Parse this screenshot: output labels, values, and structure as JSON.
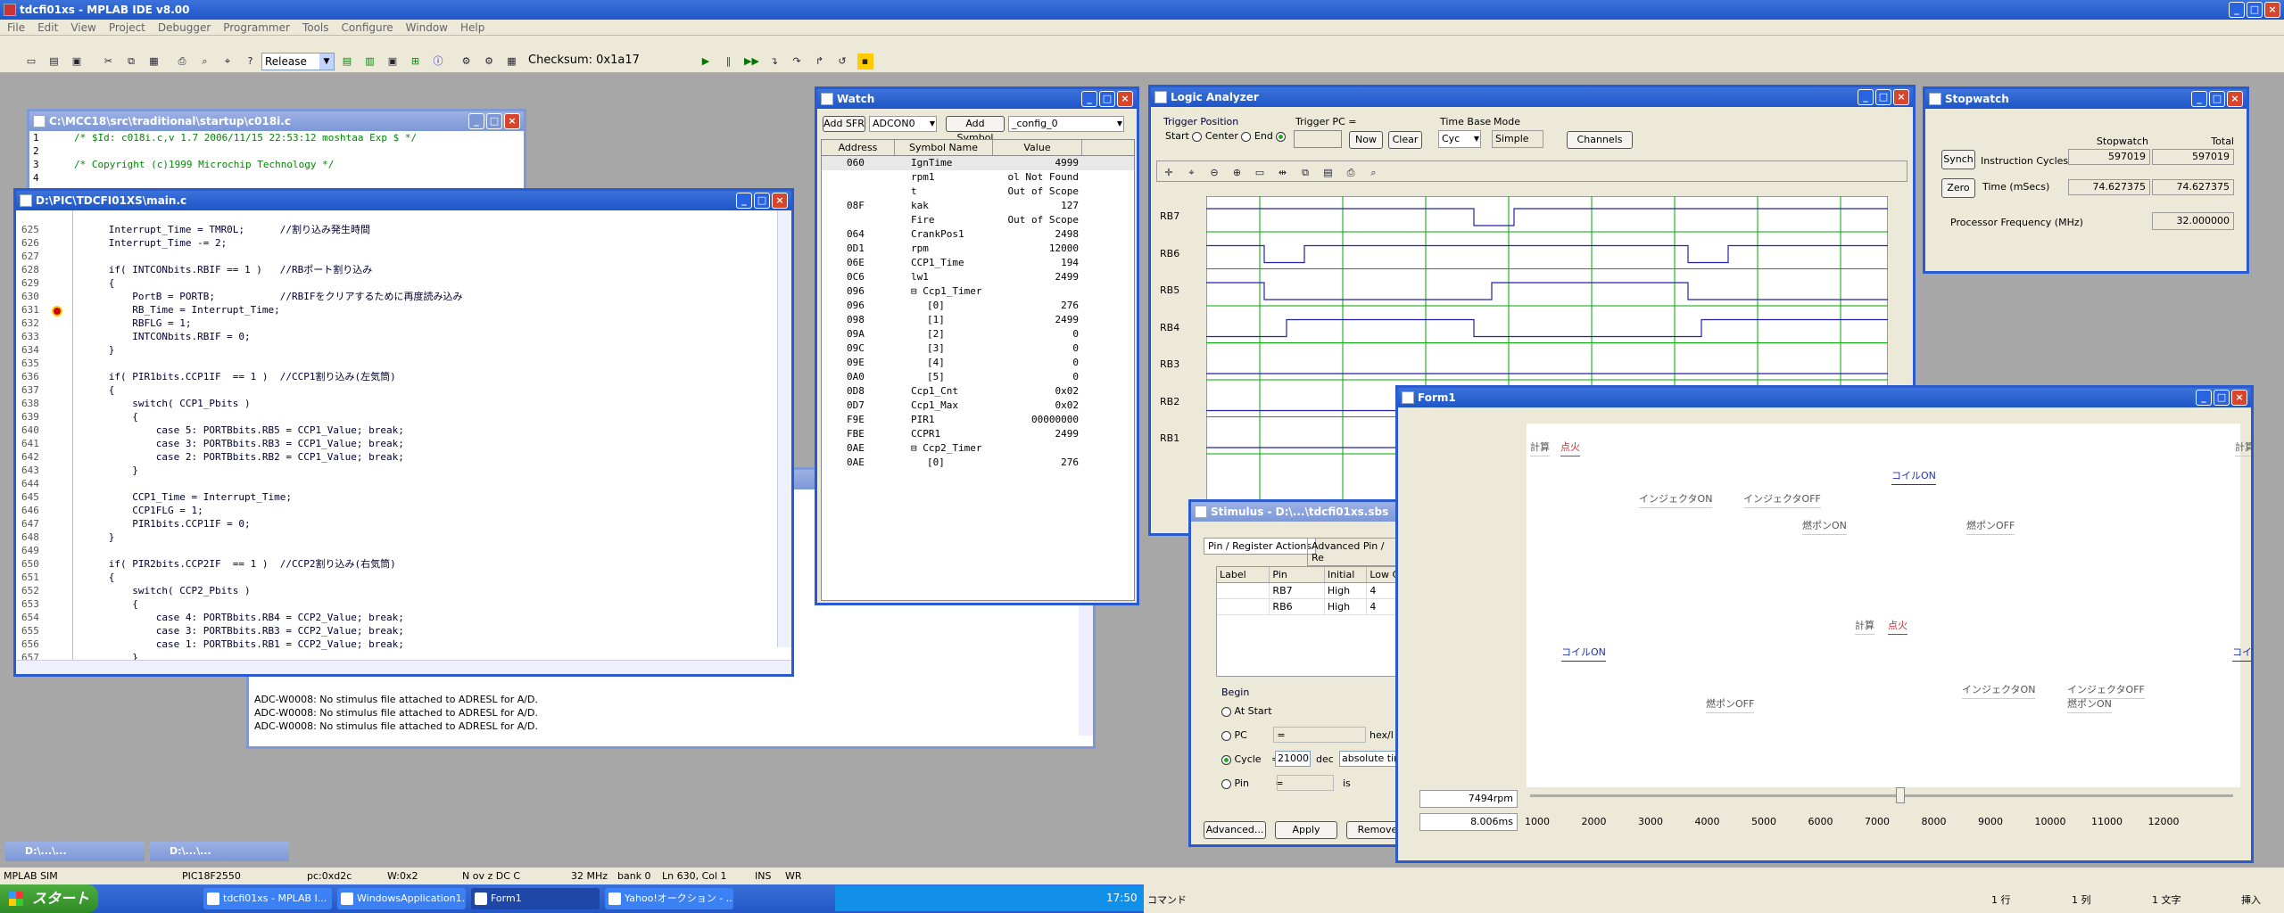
{
  "app": {
    "title": "tdcfi01xs - MPLAB IDE v8.00"
  },
  "menu": [
    "File",
    "Edit",
    "View",
    "Project",
    "Debugger",
    "Programmer",
    "Tools",
    "Configure",
    "Window",
    "Help"
  ],
  "toolbar": {
    "config": "Release",
    "checksum": "Checksum: 0x1a17"
  },
  "c018i": {
    "title": "C:\\MCC18\\src\\traditional\\startup\\c018i.c",
    "lines": [
      {
        "n": "1",
        "t": "/* $Id: c018i.c,v 1.7 2006/11/15 22:53:12 moshtaa Exp $ */"
      },
      {
        "n": "2",
        "t": ""
      },
      {
        "n": "3",
        "t": "/* Copyright (c)1999 Microchip Technology */"
      },
      {
        "n": "4",
        "t": ""
      }
    ]
  },
  "main": {
    "title": "D:\\PIC\\TDCFI01XS\\main.c",
    "lines": [
      {
        "n": "625",
        "t": "      Interrupt_Time = TMR0L;      //割り込み発生時間"
      },
      {
        "n": "626",
        "t": "      Interrupt_Time -= 2;"
      },
      {
        "n": "627",
        "t": ""
      },
      {
        "n": "628",
        "t": "      if( INTCONbits.RBIF == 1 )   //RBポート割り込み"
      },
      {
        "n": "629",
        "t": "      {"
      },
      {
        "n": "630",
        "t": "          PortB = PORTB;           //RBIFをクリアするために再度読み込み"
      },
      {
        "n": "631",
        "t": "          RB_Time = Interrupt_Time;"
      },
      {
        "n": "632",
        "t": "          RBFLG = 1;"
      },
      {
        "n": "633",
        "t": "          INTCONbits.RBIF = 0;"
      },
      {
        "n": "634",
        "t": "      }"
      },
      {
        "n": "635",
        "t": ""
      },
      {
        "n": "636",
        "t": "      if( PIR1bits.CCP1IF  == 1 )  //CCP1割り込み(左気筒)"
      },
      {
        "n": "637",
        "t": "      {"
      },
      {
        "n": "638",
        "t": "          switch( CCP1_Pbits )"
      },
      {
        "n": "639",
        "t": "          {"
      },
      {
        "n": "640",
        "t": "              case 5: PORTBbits.RB5 = CCP1_Value; break;"
      },
      {
        "n": "641",
        "t": "              case 3: PORTBbits.RB3 = CCP1_Value; break;"
      },
      {
        "n": "642",
        "t": "              case 2: PORTBbits.RB2 = CCP1_Value; break;"
      },
      {
        "n": "643",
        "t": "          }"
      },
      {
        "n": "644",
        "t": ""
      },
      {
        "n": "645",
        "t": "          CCP1_Time = Interrupt_Time;"
      },
      {
        "n": "646",
        "t": "          CCP1FLG = 1;"
      },
      {
        "n": "647",
        "t": "          PIR1bits.CCP1IF = 0;"
      },
      {
        "n": "648",
        "t": "      }"
      },
      {
        "n": "649",
        "t": ""
      },
      {
        "n": "650",
        "t": "      if( PIR2bits.CCP2IF  == 1 )  //CCP2割り込み(右気筒)"
      },
      {
        "n": "651",
        "t": "      {"
      },
      {
        "n": "652",
        "t": "          switch( CCP2_Pbits )"
      },
      {
        "n": "653",
        "t": "          {"
      },
      {
        "n": "654",
        "t": "              case 4: PORTBbits.RB4 = CCP2_Value; break;"
      },
      {
        "n": "655",
        "t": "              case 3: PORTBbits.RB3 = CCP2_Value; break;"
      },
      {
        "n": "656",
        "t": "              case 1: PORTBbits.RB1 = CCP2_Value; break;"
      },
      {
        "n": "657",
        "t": "          }"
      }
    ]
  },
  "output": {
    "lines": [
      "ADC-W0008: No stimulus file attached to ADRESL for A/D.",
      "ADC-W0008: No stimulus file attached to ADRESL for A/D.",
      "ADC-W0008: No stimulus file attached to ADRESL for A/D."
    ]
  },
  "watch": {
    "title": "Watch",
    "add_sfr": "Add SFR",
    "sfr": "ADCON0",
    "add_symbol": "Add Symbol",
    "symbol": "_config_0",
    "headers": [
      "Address",
      "Symbol Name",
      "Value"
    ],
    "rows": [
      [
        "060",
        "IgnTime",
        "4999"
      ],
      [
        "",
        "rpm1",
        "ol Not Found"
      ],
      [
        "",
        "t",
        "Out of Scope"
      ],
      [
        "08F",
        "kak",
        "127"
      ],
      [
        "",
        "Fire",
        "Out of Scope"
      ],
      [
        "064",
        "CrankPos1",
        "2498"
      ],
      [
        "0D1",
        "rpm",
        "12000"
      ],
      [
        "06E",
        "CCP1_Time",
        "194"
      ],
      [
        "0C6",
        "lw1",
        "2499"
      ],
      [
        "096",
        "⊟ Ccp1_Timer",
        ""
      ],
      [
        "096",
        "[0]",
        "276"
      ],
      [
        "098",
        "[1]",
        "2499"
      ],
      [
        "09A",
        "[2]",
        "0"
      ],
      [
        "09C",
        "[3]",
        "0"
      ],
      [
        "09E",
        "[4]",
        "0"
      ],
      [
        "0A0",
        "[5]",
        "0"
      ],
      [
        "0D8",
        "Ccp1_Cnt",
        "0x02"
      ],
      [
        "0D7",
        "Ccp1_Max",
        "0x02"
      ],
      [
        "F9E",
        "PIR1",
        "00000000"
      ],
      [
        "FBE",
        "CCPR1",
        "2499"
      ],
      [
        "0AE",
        "⊟ Ccp2_Timer",
        ""
      ],
      [
        "0AE",
        "[0]",
        "276"
      ]
    ]
  },
  "logic": {
    "title": "Logic Analyzer",
    "trigger_pos": "Trigger Position",
    "start": "Start",
    "center": "Center",
    "end": "End",
    "trigger_pc": "Trigger PC =",
    "now": "Now",
    "clear": "Clear",
    "time_base": "Time Base",
    "cyc": "Cyc",
    "mode": "Mode",
    "simple": "Simple",
    "channels": "Channels",
    "signals": [
      "RB7",
      "RB6",
      "RB5",
      "RB4",
      "RB3",
      "RB2",
      "RB1"
    ]
  },
  "stopwatch": {
    "title": "Stopwatch",
    "col1": "Stopwatch",
    "col2": "Total Simulated",
    "synch": "Synch",
    "zero": "Zero",
    "ic_label": "Instruction Cycles",
    "time_label": "Time   (mSecs)",
    "ic1": "597019",
    "ic2": "597019",
    "t1": "74.627375",
    "t2": "74.627375",
    "freq_label": "Processor Frequency    (MHz)",
    "freq": "32.000000"
  },
  "stimulus": {
    "title": "Stimulus - D:\\...\\tdcfi01xs.sbs",
    "tab1": "Pin / Register Actions",
    "tab2": "Advanced Pin / Re",
    "headers": [
      "Label",
      "Pin",
      "Initial",
      "Low C"
    ],
    "rows": [
      [
        "",
        "RB7",
        "High",
        "4"
      ],
      [
        "",
        "RB6",
        "High",
        "4"
      ]
    ],
    "begin": "Begin",
    "at_start": "At Start",
    "pc": "PC",
    "hex": "hex/l",
    "cycle": "Cycle",
    "cycle_val": "21000",
    "dec": "dec",
    "abs": "absolute time",
    "pin": "Pin",
    "is": "is",
    "advanced": "Advanced...",
    "apply": "Apply",
    "remove": "Remove"
  },
  "form1": {
    "title": "Form1",
    "rpm": "7494rpm",
    "ms": "8.006ms",
    "labels": [
      {
        "t": "計算",
        "c": "gray"
      },
      {
        "t": "点火",
        "c": "red"
      },
      {
        "t": "インジェクタON",
        "c": "gray"
      },
      {
        "t": "インジェクタOFF",
        "c": "gray"
      },
      {
        "t": "コイルON",
        "c": "blue"
      },
      {
        "t": "燃ポンON",
        "c": "gray"
      },
      {
        "t": "燃ポンOFF",
        "c": "gray"
      },
      {
        "t": "計算",
        "c": "gray"
      },
      {
        "t": "点火",
        "c": "red"
      },
      {
        "t": "計算",
        "c": "gray"
      },
      {
        "t": "点火",
        "c": "red"
      },
      {
        "t": "コイルON",
        "c": "blue"
      },
      {
        "t": "インジェクタON",
        "c": "gray"
      },
      {
        "t": "インジェクタOFF",
        "c": "gray"
      },
      {
        "t": "燃ポンOFF",
        "c": "gray"
      },
      {
        "t": "燃ポンON",
        "c": "gray"
      },
      {
        "t": "コイルON",
        "c": "blue"
      }
    ],
    "ticks": [
      "1000",
      "2000",
      "3000",
      "4000",
      "5000",
      "6000",
      "7000",
      "8000",
      "9000",
      "10000",
      "11000",
      "12000"
    ],
    "slider_value": 7494
  },
  "mini": [
    {
      "title": "D:\\...\\..."
    },
    {
      "title": "D:\\...\\..."
    }
  ],
  "status": [
    "MPLAB SIM",
    "PIC18F2550",
    "pc:0xd2c",
    "W:0x2",
    "N ov z DC C",
    "32 MHz",
    "bank 0",
    "Ln 630, Col 1",
    "INS",
    "WR"
  ],
  "taskbar": {
    "start": "スタート",
    "tasks": [
      "tdcfi01xs - MPLAB I...",
      "WindowsApplication1...",
      "Form1",
      "Yahoo!オークション - ..."
    ],
    "time": "17:50",
    "command": "コマンド",
    "ime": [
      "1 行",
      "1 列",
      "1 文字",
      "挿入"
    ]
  }
}
